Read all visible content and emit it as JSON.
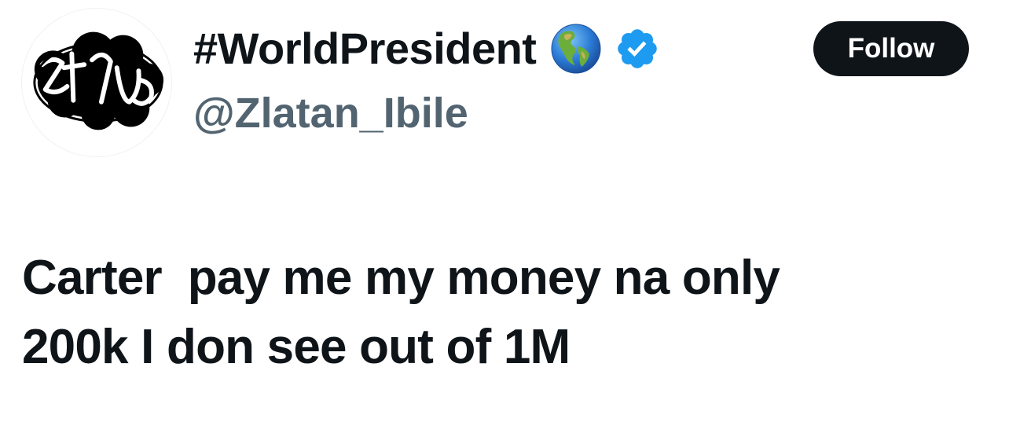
{
  "profile": {
    "display_name": "#WorldPresident",
    "handle": "@Zlatan_Ibile",
    "avatar_icon": "zlatan-logo-avatar",
    "name_badges": [
      "globe-americas-icon",
      "verified-badge-icon"
    ],
    "verified_color": "#1d9bf0"
  },
  "actions": {
    "follow_label": "Follow"
  },
  "tweet": {
    "line1": "Carter  pay me my money na only",
    "line2": "200k I don see out of 1M"
  },
  "colors": {
    "text": "#0f1419",
    "secondary_text": "#536471",
    "button_bg": "#0f1419",
    "button_text": "#ffffff"
  }
}
